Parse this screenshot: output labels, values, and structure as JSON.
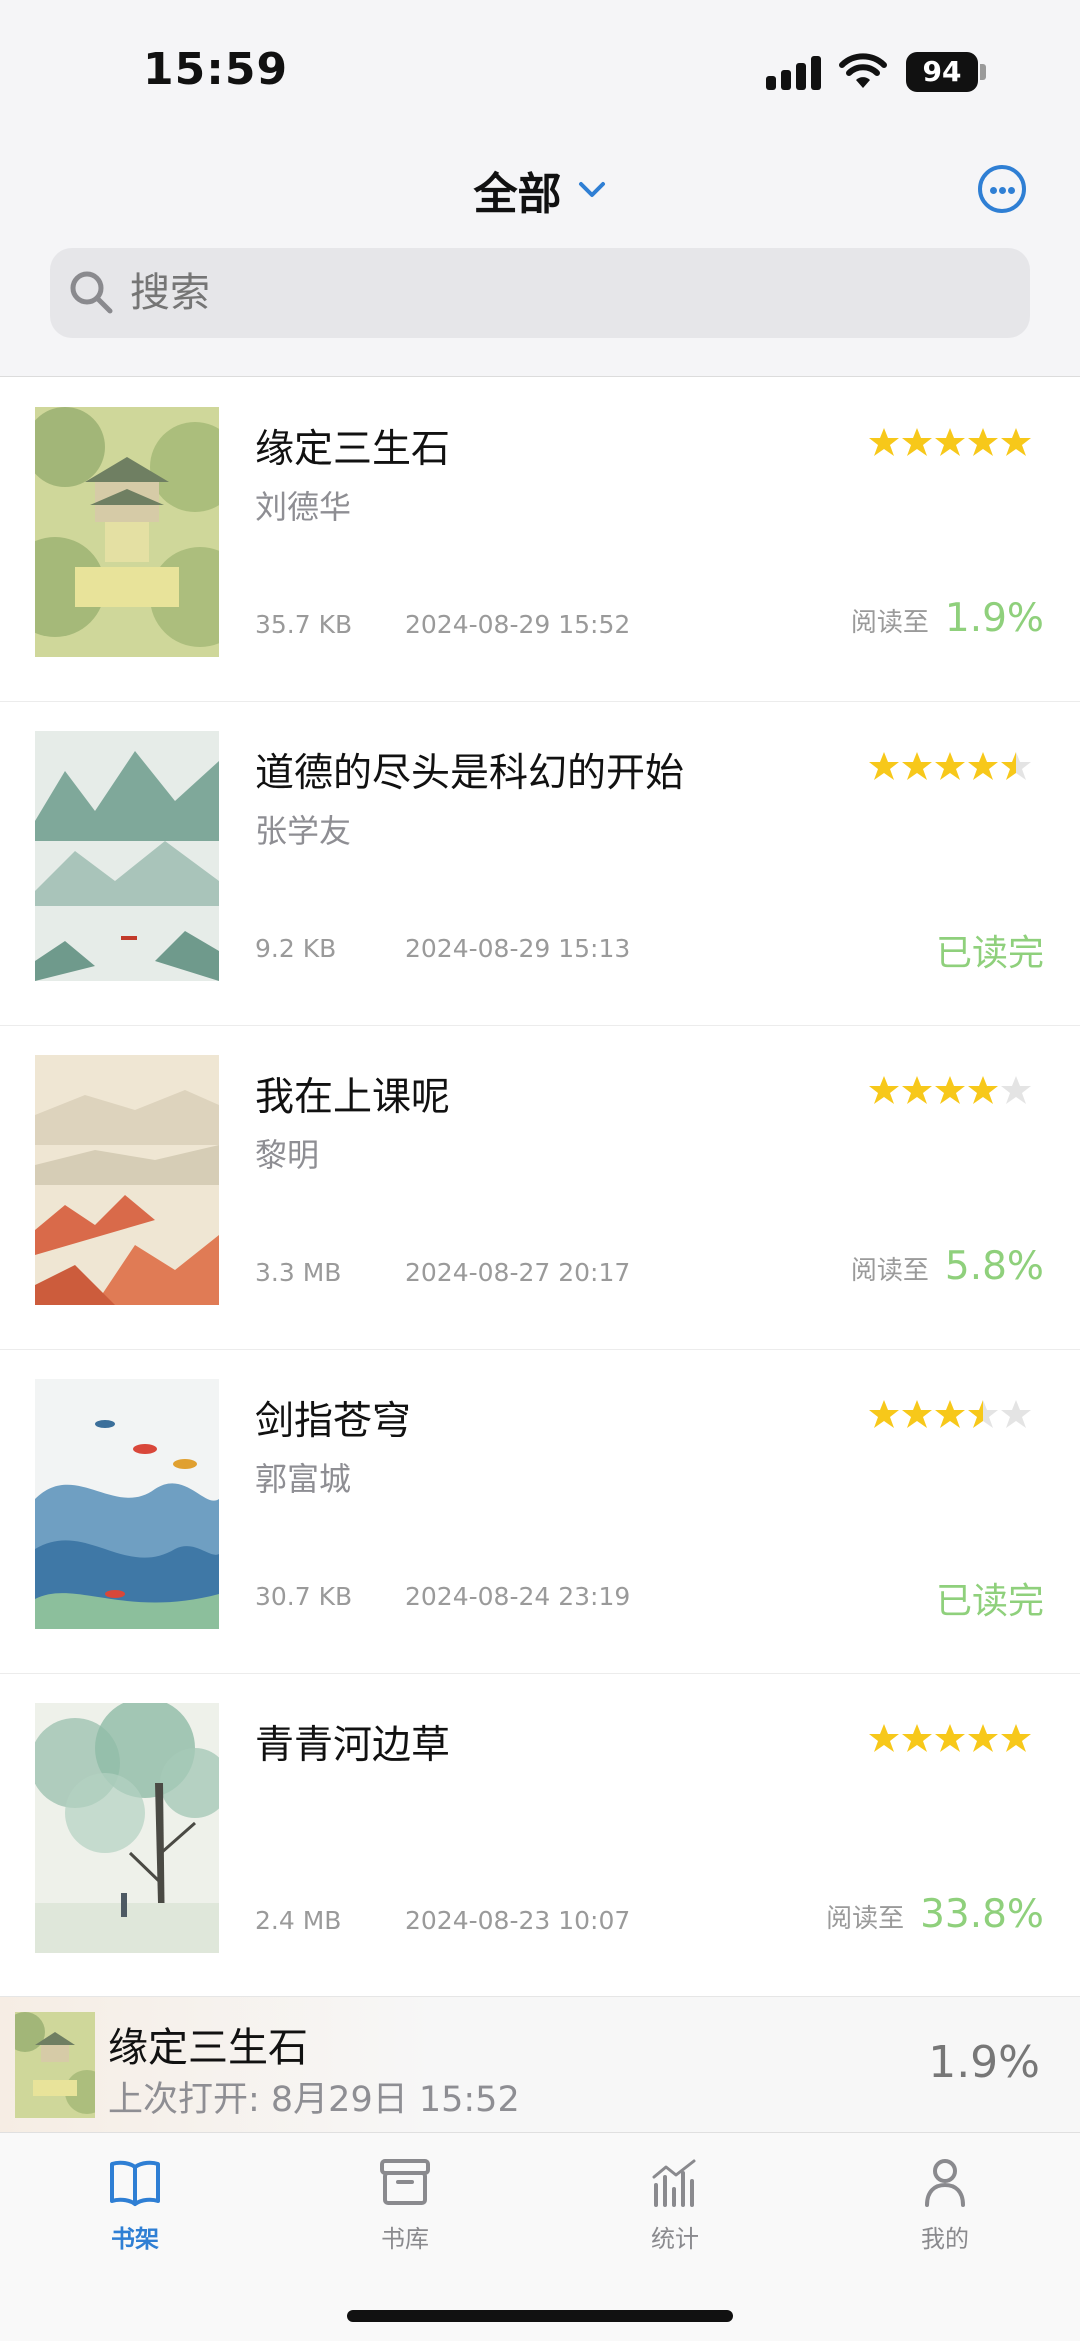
{
  "status_bar": {
    "time": "15:59",
    "battery": "94"
  },
  "header": {
    "title": "全部",
    "search_placeholder": "搜索"
  },
  "books": [
    {
      "title": "缘定三生石",
      "author": "刘德华",
      "size": "35.7 KB",
      "date": "2024-08-29 15:52",
      "rating": 5,
      "progress_label": "阅读至",
      "progress": "1.9%",
      "status": ""
    },
    {
      "title": "道德的尽头是科幻的开始",
      "author": "张学友",
      "size": "9.2 KB",
      "date": "2024-08-29 15:13",
      "rating": 4.5,
      "progress_label": "",
      "progress": "",
      "status": "已读完"
    },
    {
      "title": "我在上课呢",
      "author": "黎明",
      "size": "3.3 MB",
      "date": "2024-08-27 20:17",
      "rating": 4,
      "progress_label": "阅读至",
      "progress": "5.8%",
      "status": ""
    },
    {
      "title": "剑指苍穹",
      "author": "郭富城",
      "size": "30.7 KB",
      "date": "2024-08-24 23:19",
      "rating": 3.5,
      "progress_label": "",
      "progress": "",
      "status": "已读完"
    },
    {
      "title": "青青河边草",
      "author": "",
      "size": "2.4 MB",
      "date": "2024-08-23 10:07",
      "rating": 5,
      "progress_label": "阅读至",
      "progress": "33.8%",
      "status": ""
    }
  ],
  "mini_player": {
    "title": "缘定三生石",
    "subtitle": "上次打开: 8月29日 15:52",
    "progress": "1.9%"
  },
  "tabs": [
    {
      "label": "书架",
      "icon": "book-open-icon",
      "active": true
    },
    {
      "label": "书库",
      "icon": "archive-box-icon",
      "active": false
    },
    {
      "label": "统计",
      "icon": "bar-chart-icon",
      "active": false
    },
    {
      "label": "我的",
      "icon": "person-icon",
      "active": false
    }
  ],
  "colors": {
    "accent": "#2f7fd4",
    "star": "#f7c81a",
    "progress": "#8fd07c"
  }
}
